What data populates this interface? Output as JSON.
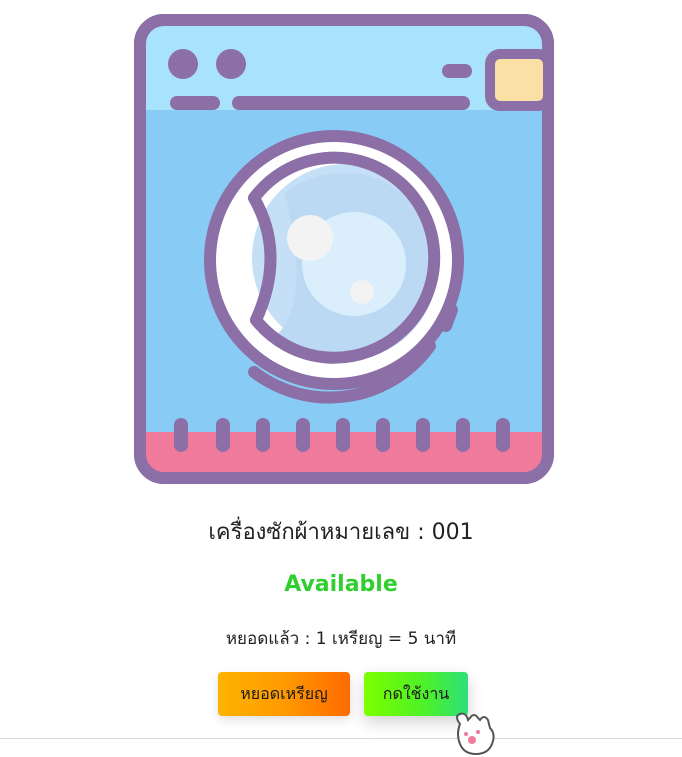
{
  "machine": {
    "title": "เครื่องซักผ้าหมายเลข : 001",
    "status": "Available",
    "coin_info": "หยอดแล้ว : 1 เหรียญ = 5 นาที"
  },
  "buttons": {
    "insert_coin": "หยอดเหรียญ",
    "start": "กดใช้งาน"
  },
  "icons": {
    "machine": "washing-machine-icon",
    "cursor": "paw-cursor-icon"
  },
  "colors": {
    "status": "#2fcf2f",
    "machine_outline": "#8b6fa6",
    "machine_body": "#87ccf5",
    "machine_base": "#ef7a9c"
  }
}
